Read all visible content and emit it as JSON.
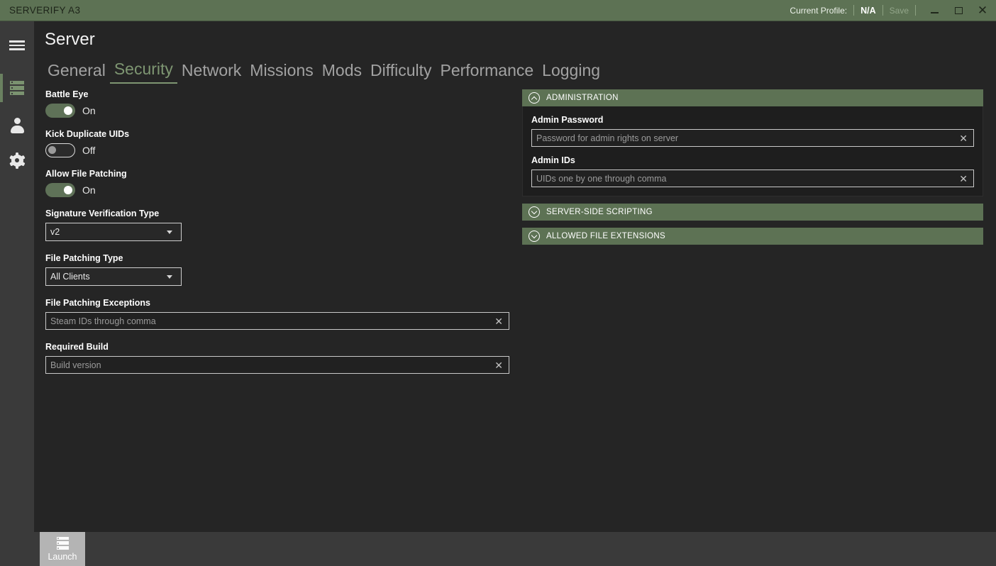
{
  "titlebar": {
    "app_title": "SERVERIFY A3",
    "profile_label": "Current Profile:",
    "profile_value": "N/A",
    "save_label": "Save",
    "minimize_icon": "minimize-icon",
    "maximize_icon": "maximize-icon",
    "close_icon": "close-icon",
    "bg_color": "#5d7254"
  },
  "sidebar": {
    "items": [
      {
        "name": "menu",
        "icon": "hamburger-icon",
        "active": false
      },
      {
        "name": "server",
        "icon": "server-icon",
        "active": true
      },
      {
        "name": "profiles",
        "icon": "person-icon",
        "active": false
      },
      {
        "name": "settings",
        "icon": "gear-icon",
        "active": false
      }
    ],
    "help_label": "?",
    "active_indicator_color": "#6a8060"
  },
  "main": {
    "page_title": "Server",
    "tabs": [
      {
        "label": "General",
        "active": false
      },
      {
        "label": "Security",
        "active": true
      },
      {
        "label": "Network",
        "active": false
      },
      {
        "label": "Missions",
        "active": false
      },
      {
        "label": "Mods",
        "active": false
      },
      {
        "label": "Difficulty",
        "active": false
      },
      {
        "label": "Performance",
        "active": false
      },
      {
        "label": "Logging",
        "active": false
      }
    ],
    "accent_color": "#7e9672"
  },
  "left_column": {
    "battle_eye": {
      "label": "Battle Eye",
      "state": "On"
    },
    "kick_duplicate_uids": {
      "label": "Kick Duplicate UIDs",
      "state": "Off"
    },
    "allow_file_patching": {
      "label": "Allow File Patching",
      "state": "On"
    },
    "signature_verification_type": {
      "label": "Signature Verification Type",
      "value": "v2"
    },
    "file_patching_type": {
      "label": "File Patching Type",
      "value": "All Clients"
    },
    "file_patching_exceptions": {
      "label": "File Patching Exceptions",
      "placeholder": "Steam IDs through comma",
      "value": ""
    },
    "required_build": {
      "label": "Required Build",
      "placeholder": "Build version",
      "value": ""
    }
  },
  "right_column": {
    "sections": [
      {
        "title": "ADMINISTRATION",
        "expanded": true
      },
      {
        "title": "SERVER-SIDE SCRIPTING",
        "expanded": false
      },
      {
        "title": "ALLOWED FILE EXTENSIONS",
        "expanded": false
      }
    ],
    "admin_password": {
      "label": "Admin Password",
      "placeholder": "Password for admin rights on server",
      "value": ""
    },
    "admin_ids": {
      "label": "Admin IDs",
      "placeholder": "UIDs one by one through comma",
      "value": ""
    }
  },
  "footer": {
    "launch_label": "Launch",
    "launch_icon": "server-icon"
  }
}
